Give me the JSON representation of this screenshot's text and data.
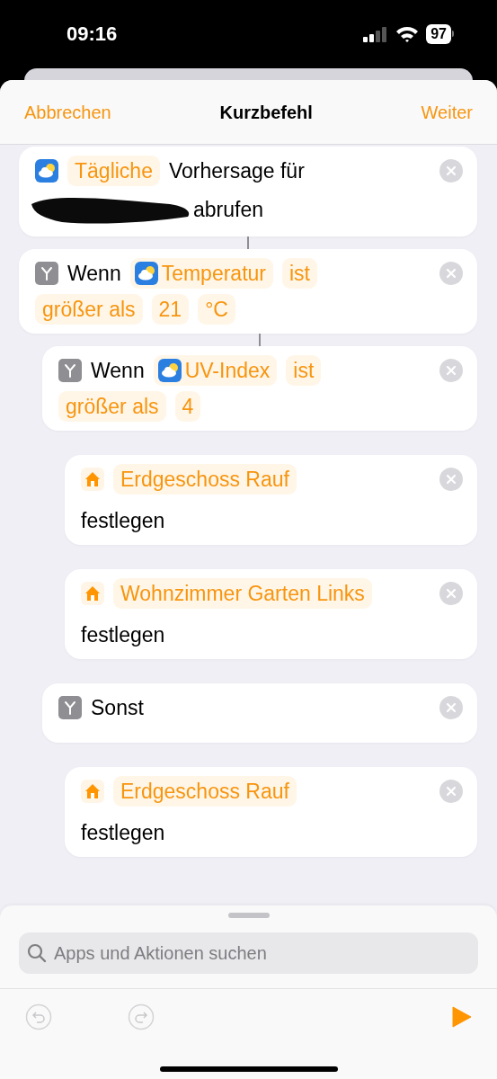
{
  "status_bar": {
    "time": "09:16",
    "battery": "97"
  },
  "nav": {
    "cancel": "Abbrechen",
    "title": "Kurzbefehl",
    "next": "Weiter"
  },
  "actions": [
    {
      "kind": "weather",
      "parts": [
        {
          "kind": "token",
          "text": "Tägliche"
        },
        {
          "kind": "text",
          "text": "Vorhersage für"
        },
        {
          "kind": "redacted"
        },
        {
          "kind": "text",
          "text": "abrufen"
        }
      ]
    },
    {
      "kind": "if",
      "parts": [
        {
          "kind": "text",
          "text": "Wenn"
        },
        {
          "kind": "variable",
          "text": "Temperatur"
        },
        {
          "kind": "token",
          "text": "ist"
        },
        {
          "kind": "token",
          "text": "größer als"
        },
        {
          "kind": "token",
          "text": "21"
        },
        {
          "kind": "token",
          "text": "°C"
        }
      ],
      "children": [
        {
          "kind": "if",
          "parts": [
            {
              "kind": "text",
              "text": "Wenn"
            },
            {
              "kind": "variable",
              "text": "UV-Index"
            },
            {
              "kind": "token",
              "text": "ist"
            },
            {
              "kind": "token",
              "text": "größer als"
            },
            {
              "kind": "token",
              "text": "4"
            }
          ],
          "children": [
            {
              "kind": "home",
              "parts": [
                {
                  "kind": "token",
                  "text": "Erdgeschoss Rauf"
                },
                {
                  "kind": "text",
                  "text": "festlegen"
                }
              ]
            },
            {
              "kind": "home",
              "parts": [
                {
                  "kind": "token",
                  "text": "Wohnzimmer Garten Links"
                },
                {
                  "kind": "text",
                  "text": "festlegen"
                }
              ]
            }
          ]
        },
        {
          "kind": "else",
          "parts": [
            {
              "kind": "text",
              "text": "Sonst"
            }
          ],
          "children": [
            {
              "kind": "home",
              "parts": [
                {
                  "kind": "token",
                  "text": "Erdgeschoss Rauf"
                },
                {
                  "kind": "text",
                  "text": "festlegen"
                }
              ]
            }
          ]
        }
      ]
    }
  ],
  "search": {
    "placeholder": "Apps und Aktionen suchen"
  }
}
